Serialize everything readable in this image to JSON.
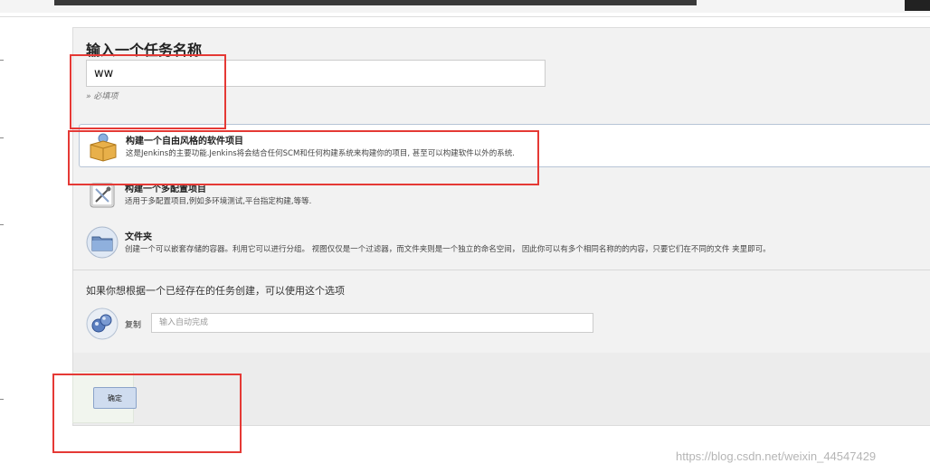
{
  "page": {
    "title": "输入一个任务名称",
    "name_value": "ww",
    "required_hint": "» 必填项"
  },
  "item_types": [
    {
      "name": "构建一个自由风格的软件项目",
      "description": "这是Jenkins的主要功能.Jenkins将会结合任何SCM和任何构建系统来构建你的项目, 甚至可以构建软件以外的系统.",
      "icon": "freestyle-package-icon",
      "selected": true
    },
    {
      "name": "构建一个多配置项目",
      "description": "适用于多配置项目,例如多环境测试,平台指定构建,等等.",
      "icon": "multi-config-icon",
      "selected": false
    },
    {
      "name": "文件夹",
      "description": "创建一个可以嵌套存储的容器。利用它可以进行分组。 视图仅仅是一个过滤器，而文件夹则是一个独立的命名空间， 因此你可以有多个相同名称的的内容，只要它们在不同的文件 夹里即可。",
      "icon": "folder-icon",
      "selected": false
    }
  ],
  "copy": {
    "label": "如果你想根据一个已经存在的任务创建，可以使用这个选项",
    "field_label": "复制",
    "placeholder": "输入自动完成",
    "icon": "copy-spheres-icon"
  },
  "actions": {
    "ok_label": "确定"
  },
  "watermark": "https://blog.csdn.net/weixin_44547429",
  "colors": {
    "highlight": "#e53935",
    "button_bg": "#cfdcef",
    "selected_border": "#b7c4d6"
  }
}
